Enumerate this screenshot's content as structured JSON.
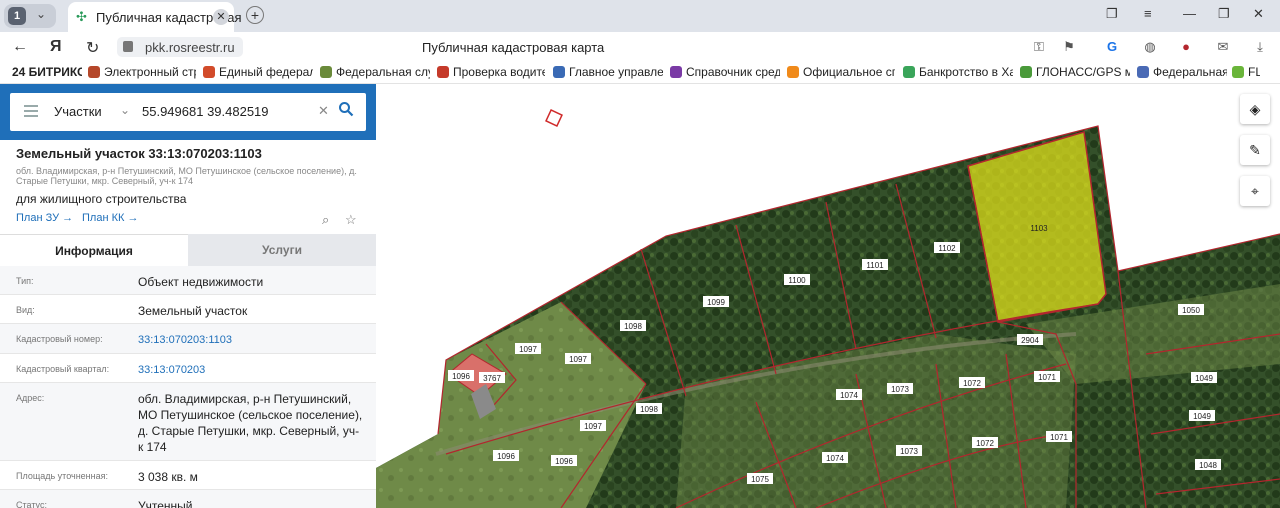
{
  "browser": {
    "tab_count": "1",
    "tab_title": "Публичная кадастровая",
    "url": "pkk.rosreestr.ru",
    "page_title": "Публичная кадастровая карта"
  },
  "bookmarks": [
    {
      "label": "24 БИТРИКС",
      "color": "#1f8fd6"
    },
    {
      "label": "Электронный стр",
      "color": "#b5472a"
    },
    {
      "label": "Единый федераль",
      "color": "#d24b2a"
    },
    {
      "label": "Федеральная служ",
      "color": "#6a8a3a"
    },
    {
      "label": "Проверка водите",
      "color": "#c53a2a"
    },
    {
      "label": "Главное управлен",
      "color": "#3a6ab5"
    },
    {
      "label": "Справочник сред",
      "color": "#7a3aa5"
    },
    {
      "label": "Официальное спи",
      "color": "#f08a1a"
    },
    {
      "label": "Банкротство в Ха",
      "color": "#3aa55a"
    },
    {
      "label": "ГЛОНАСС/GPS мо",
      "color": "#4a9a3a"
    },
    {
      "label": "Федеральная",
      "color": "#4a6ab5"
    },
    {
      "label": "FL",
      "color": "#6ab53a"
    }
  ],
  "search": {
    "type_label": "Участки",
    "query": "55.949681 39.482519"
  },
  "parcel": {
    "title": "Земельный участок 33:13:070203:1103",
    "address_short": "обл. Владимирская, р-н Петушинский, МО Петушинское (сельское поселение), д. Старые Петушки, мкр. Северный, уч-к 174",
    "usage": "для жилищного строительства",
    "plan_zu": "План ЗУ",
    "plan_kk": "План КК"
  },
  "tabs": {
    "info": "Информация",
    "services": "Услуги"
  },
  "rows": [
    {
      "label": "Тип:",
      "value": "Объект недвижимости"
    },
    {
      "label": "Вид:",
      "value": "Земельный участок"
    },
    {
      "label": "Кадастровый номер:",
      "value": "33:13:070203:1103"
    },
    {
      "label": "Кадастровый квартал:",
      "value": "33:13:070203"
    },
    {
      "label": "Адрес:",
      "value": "обл. Владимирская, р-н Петушинский, МО Петушинское (сельское поселение), д. Старые Петушки, мкр. Северный, уч-к 174"
    },
    {
      "label": "Площадь уточненная:",
      "value": "3 038 кв. м"
    },
    {
      "label": "Статус:",
      "value": "Учтенный"
    }
  ],
  "map": {
    "parcel_labels": [
      "1103",
      "1102",
      "1101",
      "1100",
      "1099",
      "1098",
      "1097",
      "1097",
      "1096",
      "3767",
      "1098",
      "1097",
      "1096",
      "1096",
      "2904",
      "1073",
      "1072",
      "1071",
      "1074",
      "1073",
      "1072",
      "1071",
      "1074",
      "1075",
      "1050",
      "1049",
      "1049",
      "1048"
    ],
    "highlight_color": "#e4e41a",
    "boundary_color": "#b3262e"
  }
}
